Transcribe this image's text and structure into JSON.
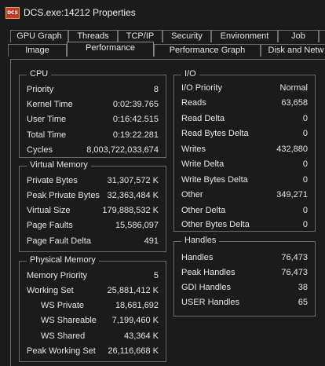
{
  "window": {
    "icon_text": "DCS",
    "title": "DCS.exe:14212 Properties"
  },
  "tabs_back": [
    {
      "label": "GPU Graph"
    },
    {
      "label": "Threads"
    },
    {
      "label": "TCP/IP"
    },
    {
      "label": "Security"
    },
    {
      "label": "Environment"
    },
    {
      "label": "Job"
    },
    {
      "label": ""
    }
  ],
  "tabs_front": [
    {
      "label": "Image"
    },
    {
      "label": "Performance"
    },
    {
      "label": "Performance Graph"
    },
    {
      "label": "Disk and Netw"
    }
  ],
  "cpu": {
    "title": "CPU",
    "rows": [
      {
        "label": "Priority",
        "value": "8"
      },
      {
        "label": "Kernel Time",
        "value": "0:02:39.765"
      },
      {
        "label": "User Time",
        "value": "0:16:42.515"
      },
      {
        "label": "Total Time",
        "value": "0:19:22.281"
      },
      {
        "label": "Cycles",
        "value": "8,003,722,033,674"
      }
    ]
  },
  "virtual_memory": {
    "title": "Virtual Memory",
    "rows": [
      {
        "label": "Private Bytes",
        "value": "31,307,572 K"
      },
      {
        "label": "Peak Private Bytes",
        "value": "32,363,484 K"
      },
      {
        "label": "Virtual Size",
        "value": "179,888,532 K"
      },
      {
        "label": "Page Faults",
        "value": "15,586,097"
      },
      {
        "label": "Page Fault Delta",
        "value": "491"
      }
    ]
  },
  "physical_memory": {
    "title": "Physical Memory",
    "rows": [
      {
        "label": "Memory Priority",
        "value": "5",
        "indent": false
      },
      {
        "label": "Working Set",
        "value": "25,881,412 K",
        "indent": false
      },
      {
        "label": "WS Private",
        "value": "18,681,692",
        "indent": true
      },
      {
        "label": "WS Shareable",
        "value": "7,199,460 K",
        "indent": true
      },
      {
        "label": "WS Shared",
        "value": "43,364 K",
        "indent": true
      },
      {
        "label": "Peak Working Set",
        "value": "26,116,668 K",
        "indent": false
      }
    ]
  },
  "io": {
    "title": "I/O",
    "rows": [
      {
        "label": "I/O Priority",
        "value": "Normal"
      },
      {
        "label": "Reads",
        "value": "63,658"
      },
      {
        "label": "Read Delta",
        "value": "0"
      },
      {
        "label": "Read Bytes Delta",
        "value": "0"
      },
      {
        "label": "Writes",
        "value": "432,880"
      },
      {
        "label": "Write Delta",
        "value": "0"
      },
      {
        "label": "Write Bytes Delta",
        "value": "0"
      },
      {
        "label": "Other",
        "value": "349,271"
      },
      {
        "label": "Other Delta",
        "value": "0"
      },
      {
        "label": "Other Bytes Delta",
        "value": "0"
      }
    ]
  },
  "handles": {
    "title": "Handles",
    "rows": [
      {
        "label": "Handles",
        "value": "76,473"
      },
      {
        "label": "Peak Handles",
        "value": "76,473"
      },
      {
        "label": "GDI Handles",
        "value": "38"
      },
      {
        "label": "USER Handles",
        "value": "65"
      }
    ]
  }
}
